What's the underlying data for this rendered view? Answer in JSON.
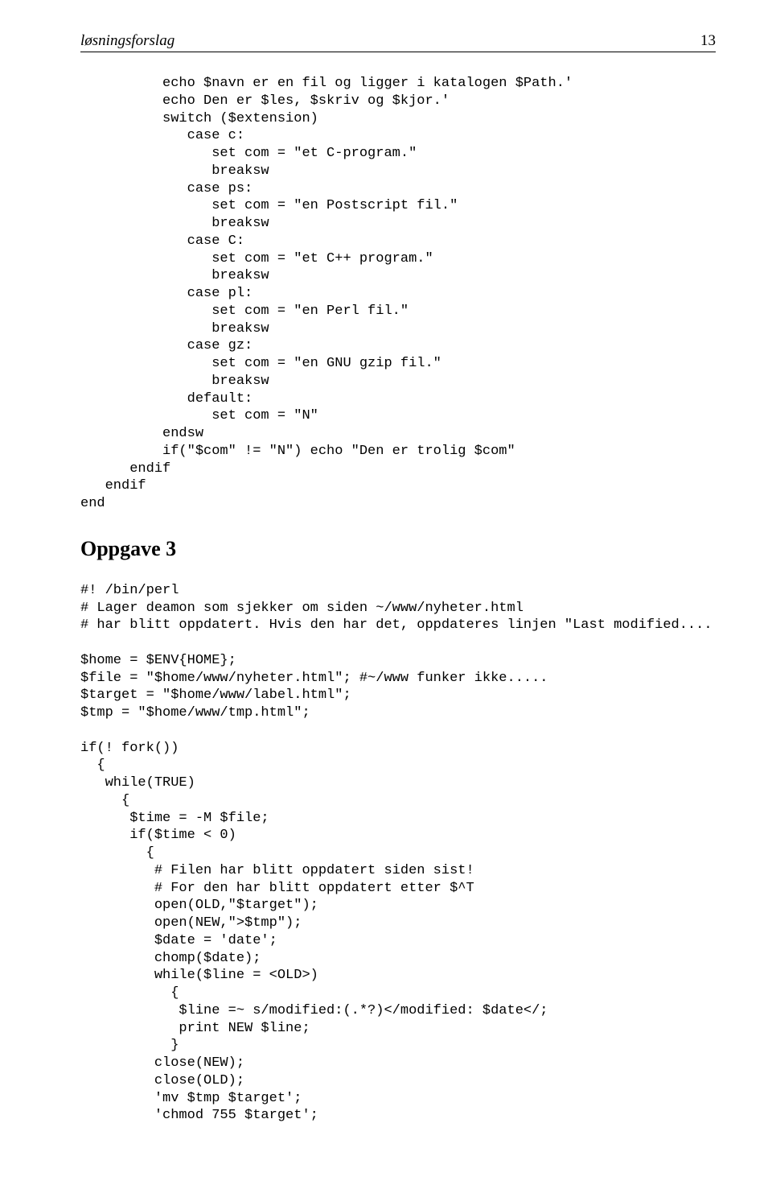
{
  "header": {
    "title": "løsningsforslag",
    "page": "13"
  },
  "code1": "          echo $navn er en fil og ligger i katalogen $Path.'\n          echo Den er $les, $skriv og $kjor.'\n          switch ($extension)\n             case c:\n                set com = \"et C-program.\"\n                breaksw\n             case ps:\n                set com = \"en Postscript fil.\"\n                breaksw\n             case C:\n                set com = \"et C++ program.\"\n                breaksw\n             case pl:\n                set com = \"en Perl fil.\"\n                breaksw\n             case gz:\n                set com = \"en GNU gzip fil.\"\n                breaksw\n             default:\n                set com = \"N\"\n          endsw\n          if(\"$com\" != \"N\") echo \"Den er trolig $com\"\n      endif\n   endif\nend",
  "heading3": "Oppgave 3",
  "code2": "#! /bin/perl\n# Lager deamon som sjekker om siden ~/www/nyheter.html\n# har blitt oppdatert. Hvis den har det, oppdateres linjen \"Last modified....\n\n$home = $ENV{HOME};\n$file = \"$home/www/nyheter.html\"; #~/www funker ikke.....\n$target = \"$home/www/label.html\";\n$tmp = \"$home/www/tmp.html\";\n\nif(! fork())\n  {\n   while(TRUE)\n     {\n      $time = -M $file;\n      if($time < 0)\n        {\n         # Filen har blitt oppdatert siden sist!\n         # For den har blitt oppdatert etter $^T\n         open(OLD,\"$target\");\n         open(NEW,\">$tmp\");\n         $date = 'date';\n         chomp($date);\n         while($line = <OLD>)\n           {\n            $line =~ s/modified:(.*?)</modified: $date</;\n            print NEW $line;\n           }\n         close(NEW);\n         close(OLD);\n         'mv $tmp $target';\n         'chmod 755 $target';"
}
